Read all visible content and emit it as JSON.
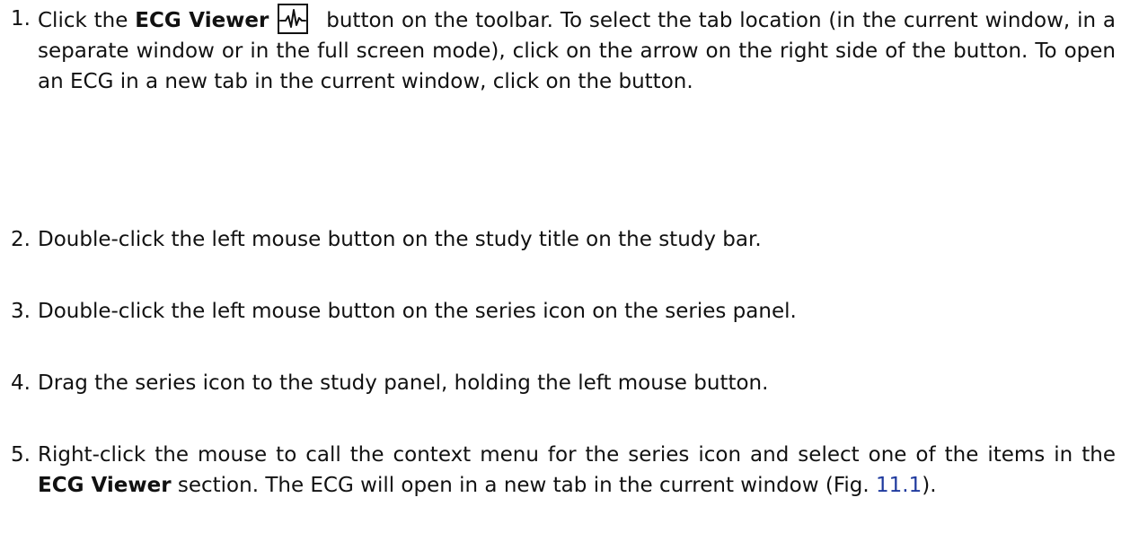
{
  "steps": [
    {
      "num": "1.",
      "pre": "Click the ",
      "bold": "ECG Viewer",
      "icon": "ecg-viewer-icon",
      "post": " button on the toolbar.  To select the tab location (in the current window, in a separate window or in the full screen mode), click on the arrow on the right side of the button.  To open an ECG in a new tab in the current window, click on the button."
    },
    {
      "num": "2.",
      "text": "Double-click the left mouse button on the study title on the study bar."
    },
    {
      "num": "3.",
      "text": "Double-click the left mouse button on the series icon on the series panel."
    },
    {
      "num": "4.",
      "text": "Drag the series icon to the study panel, holding the left mouse button."
    },
    {
      "num": "5.",
      "pre": "Right-click the mouse to call the context menu for the series icon and select one of the items in the ",
      "bold": "ECG Viewer",
      "mid": " section.  The ECG will open in a new tab in the current window (Fig. ",
      "fig_ref": "11.1",
      "post": ")."
    }
  ],
  "colors": {
    "text": "#111111",
    "link": "#1f3a9e"
  }
}
